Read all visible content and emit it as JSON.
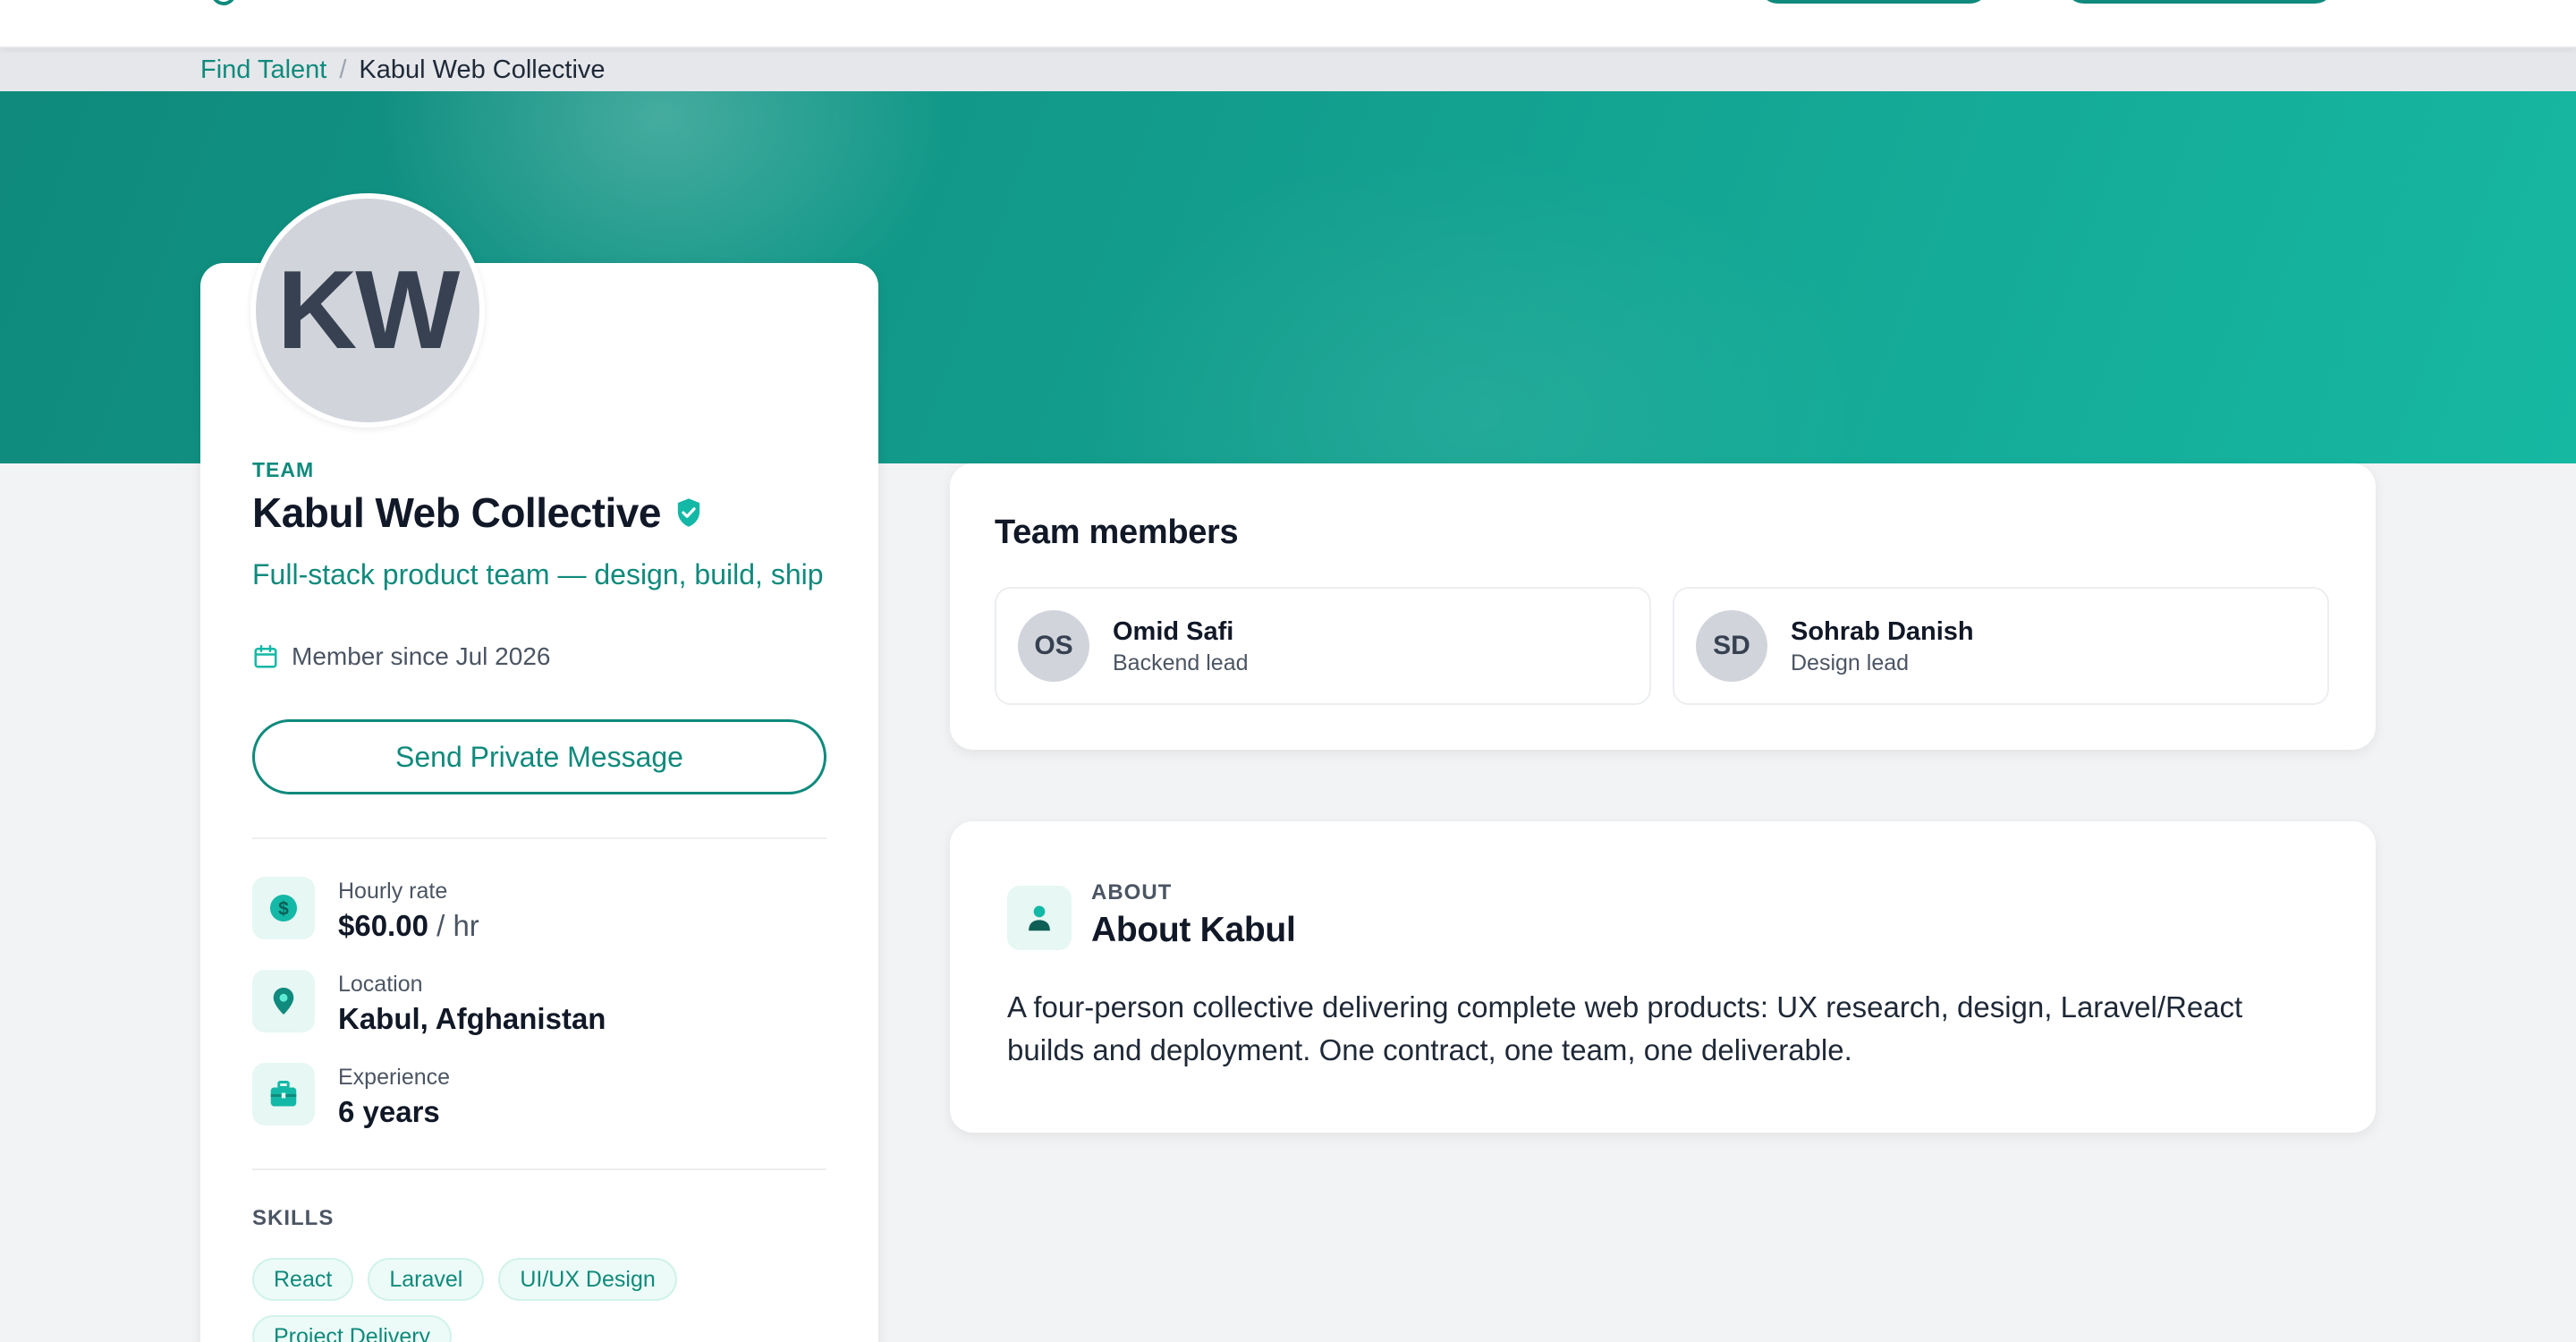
{
  "breadcrumb": {
    "parent_label": "Find Talent",
    "separator": "/",
    "current_label": "Kabul Web Collective"
  },
  "profile": {
    "avatar_initials": "KW",
    "kind_label": "TEAM",
    "name": "Kabul Web Collective",
    "verified": true,
    "tagline": "Full-stack product team — design, build, ship",
    "member_since": "Member since Jul 2026",
    "message_button_label": "Send Private Message",
    "stats": {
      "hourly_rate": {
        "label": "Hourly rate",
        "value": "$60.00",
        "unit": " / hr",
        "icon": "dollar-icon"
      },
      "location": {
        "label": "Location",
        "value": "Kabul, Afghanistan",
        "icon": "map-pin-icon"
      },
      "experience": {
        "label": "Experience",
        "value": "6 years",
        "icon": "briefcase-icon"
      }
    },
    "skills_title": "SKILLS",
    "skills": [
      "React",
      "Laravel",
      "UI/UX Design",
      "Project Delivery"
    ]
  },
  "team": {
    "title": "Team members",
    "members": [
      {
        "initials": "OS",
        "name": "Omid Safi",
        "role": "Backend lead"
      },
      {
        "initials": "SD",
        "name": "Sohrab Danish",
        "role": "Design lead"
      }
    ]
  },
  "about": {
    "eyebrow": "ABOUT",
    "title": "About Kabul",
    "body": "A four-person collective delivering complete web products: UX research, design, Laravel/React builds and deployment. One contract, one team, one deliverable."
  },
  "colors": {
    "accent": "#0f8a7c",
    "hero_start": "#0f8a7c",
    "hero_end": "#16b8a2",
    "page_bg": "#f2f3f5"
  }
}
